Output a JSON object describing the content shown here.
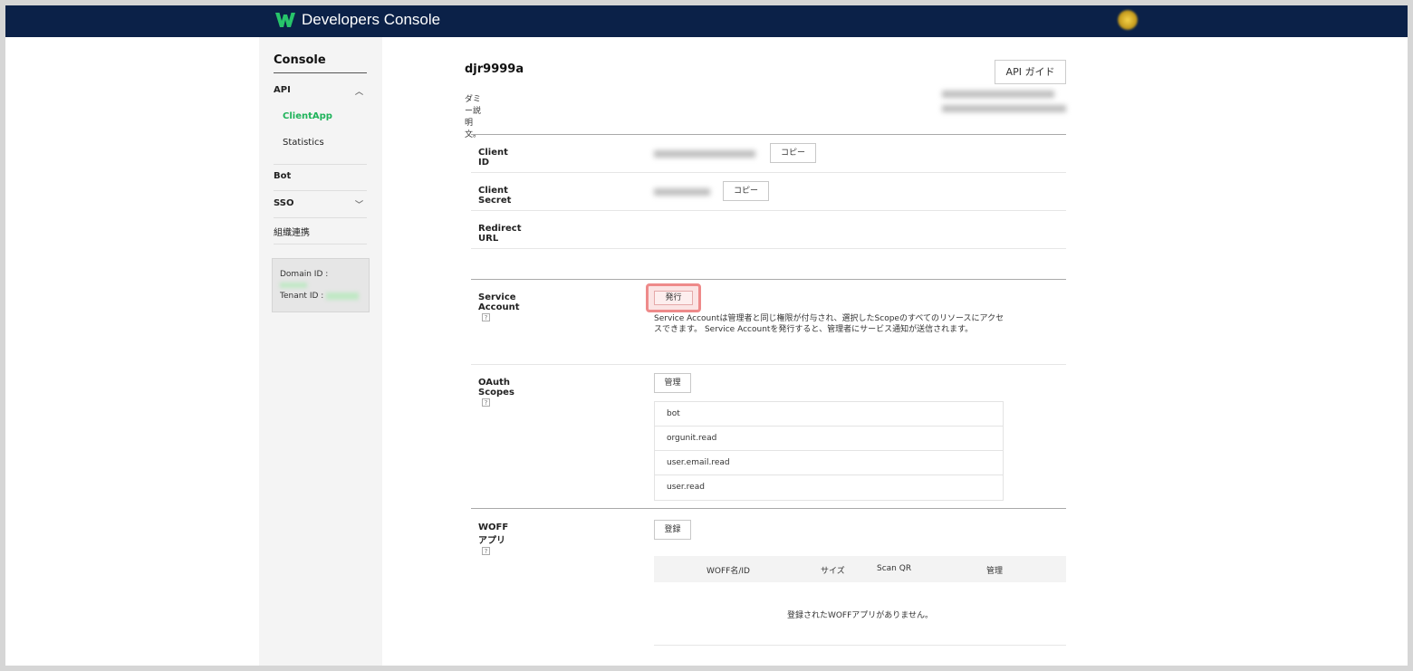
{
  "header": {
    "brand": "Developers Console",
    "logo_icon": "works-w-logo-icon",
    "logo_color": "#27c46a",
    "bar_color": "#0b2148"
  },
  "sidebar": {
    "title": "Console",
    "items": [
      {
        "label": "API",
        "chevron": "chevron-up-icon"
      },
      {
        "label": "ClientApp",
        "active": true
      },
      {
        "label": "Statistics"
      },
      {
        "label": "Bot"
      },
      {
        "label": "SSO",
        "chevron": "chevron-down-icon"
      },
      {
        "label": "組織連携"
      }
    ],
    "domain_label": "Domain ID :",
    "tenant_label": "Tenant ID :",
    "accent_color": "#1fb35a"
  },
  "app": {
    "name": "djr9999a",
    "description": "ダミー説明文。",
    "guide_button": "API ガイド"
  },
  "fields": {
    "client_id": {
      "label": "Client ID",
      "copy": "コピー"
    },
    "client_secret": {
      "label": "Client Secret",
      "copy": "コピー"
    },
    "redirect_url": {
      "label": "Redirect URL"
    }
  },
  "service_account": {
    "label": "Service Account",
    "help": "?",
    "issue_button": "発行",
    "description": "Service Accountは管理者と同じ権限が付与され、選択したScopeのすべてのリソースにアクセスできます。 Service Accountを発行すると、管理者にサービス通知が送信されます。"
  },
  "oauth": {
    "label": "OAuth Scopes",
    "help": "?",
    "manage_button": "管理",
    "scopes": [
      "bot",
      "orgunit.read",
      "user.email.read",
      "user.read"
    ]
  },
  "woff": {
    "label": "WOFFアプリ",
    "help": "?",
    "register_button": "登録",
    "columns": [
      "WOFF名/ID",
      "サイズ",
      "Scan QR",
      "管理"
    ],
    "empty_message": "登録されたWOFFアプリがありません。"
  }
}
